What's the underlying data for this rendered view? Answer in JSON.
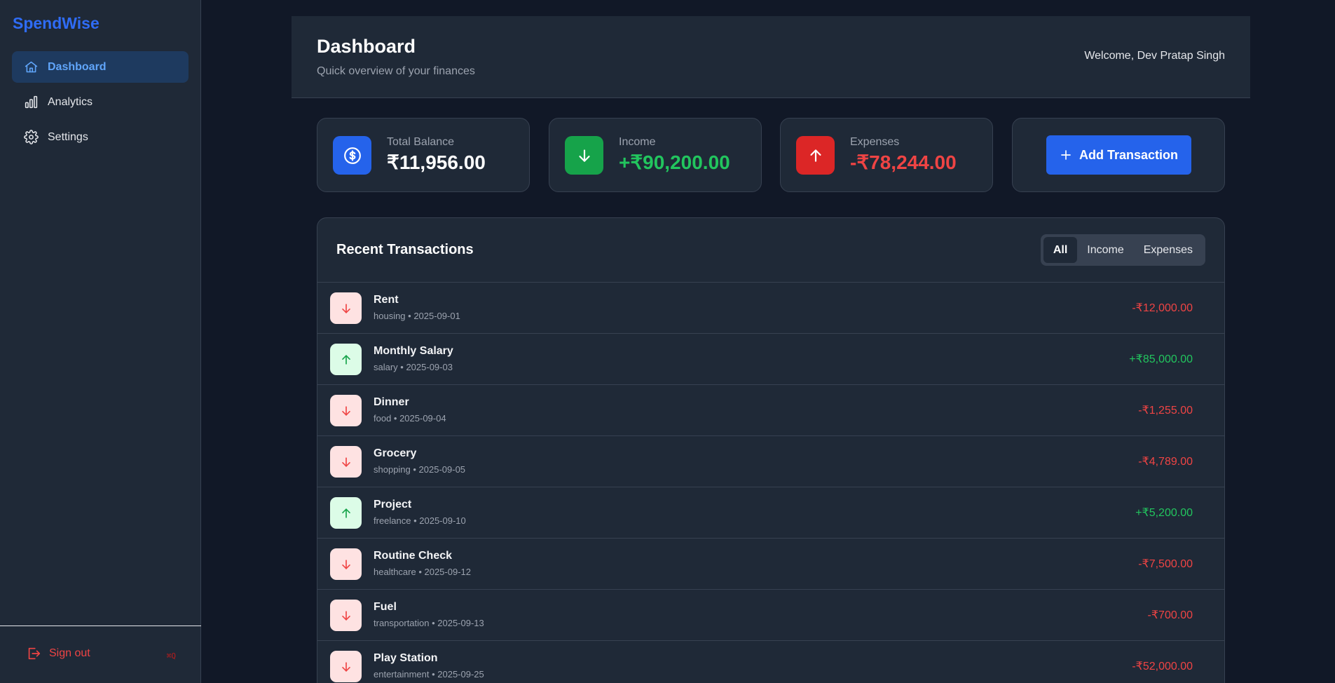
{
  "app": {
    "brand": "SpendWise"
  },
  "sidebar": {
    "items": [
      {
        "label": "Dashboard",
        "icon": "home-icon",
        "active": true
      },
      {
        "label": "Analytics",
        "icon": "bar-chart-icon",
        "active": false
      },
      {
        "label": "Settings",
        "icon": "gear-icon",
        "active": false
      }
    ],
    "signout_label": "Sign out",
    "shortcut": "⌘Q"
  },
  "header": {
    "title": "Dashboard",
    "subtitle": "Quick overview of your finances",
    "welcome": "Welcome, Dev Pratap Singh"
  },
  "cards": {
    "balance": {
      "label": "Total Balance",
      "value": "₹11,956.00",
      "color": "#2563eb"
    },
    "income": {
      "label": "Income",
      "value": "+₹90,200.00",
      "color": "#16a34a"
    },
    "expenses": {
      "label": "Expenses",
      "value": "-₹78,244.00",
      "color": "#dc2626"
    }
  },
  "add_button": {
    "label": "Add Transaction"
  },
  "transactions": {
    "title": "Recent Transactions",
    "filters": [
      "All",
      "Income",
      "Expenses"
    ],
    "active_filter": "All",
    "rows": [
      {
        "name": "Rent",
        "meta": "housing • 2025-09-01",
        "amount": "-₹12,000.00",
        "type": "expense"
      },
      {
        "name": "Monthly Salary",
        "meta": "salary • 2025-09-03",
        "amount": "+₹85,000.00",
        "type": "income"
      },
      {
        "name": "Dinner",
        "meta": "food • 2025-09-04",
        "amount": "-₹1,255.00",
        "type": "expense"
      },
      {
        "name": "Grocery",
        "meta": "shopping • 2025-09-05",
        "amount": "-₹4,789.00",
        "type": "expense"
      },
      {
        "name": "Project",
        "meta": "freelance • 2025-09-10",
        "amount": "+₹5,200.00",
        "type": "income"
      },
      {
        "name": "Routine Check",
        "meta": "healthcare • 2025-09-12",
        "amount": "-₹7,500.00",
        "type": "expense"
      },
      {
        "name": "Fuel",
        "meta": "transportation • 2025-09-13",
        "amount": "-₹700.00",
        "type": "expense"
      },
      {
        "name": "Play Station",
        "meta": "entertainment • 2025-09-25",
        "amount": "-₹52,000.00",
        "type": "expense"
      }
    ]
  },
  "colors": {
    "accent": "#2563eb",
    "positive": "#22c55e",
    "negative": "#ef4444",
    "background": "#111827",
    "surface": "#1f2937"
  }
}
